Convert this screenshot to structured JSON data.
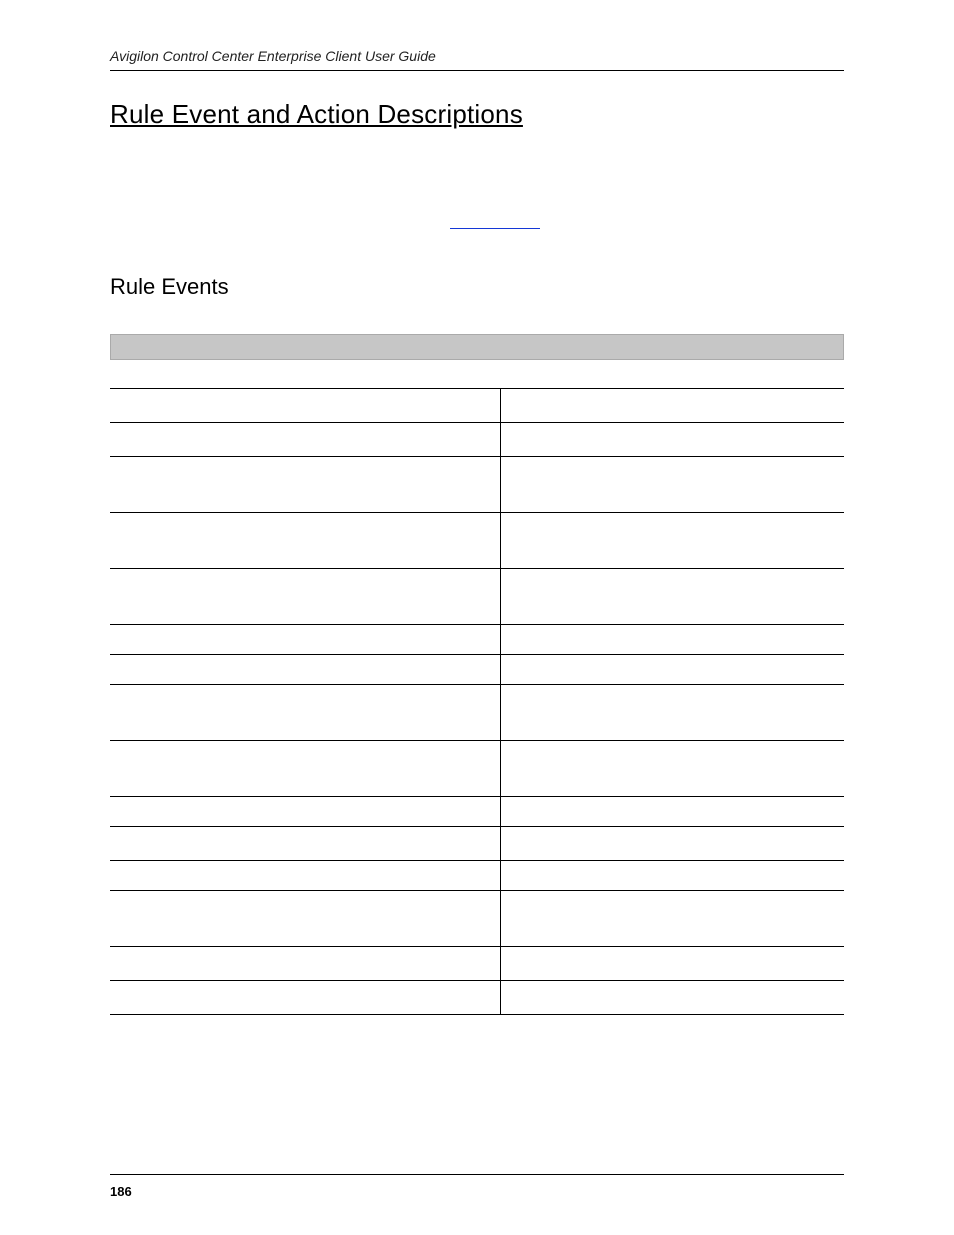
{
  "header": {
    "running": "Avigilon Control Center Enterprise Client User Guide"
  },
  "content": {
    "h1": "Rule Event and Action Descriptions",
    "h2": "Rule Events"
  },
  "footer": {
    "page_number": "186"
  }
}
